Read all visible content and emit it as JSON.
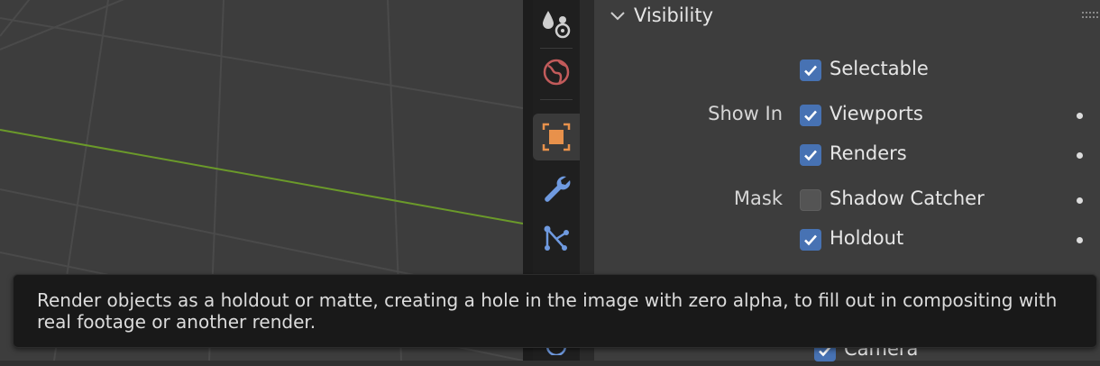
{
  "panel": {
    "title": "Visibility",
    "rows": [
      {
        "label": "",
        "option": "Selectable",
        "checked": true,
        "has_dot": false
      },
      {
        "label": "Show In",
        "option": "Viewports",
        "checked": true,
        "has_dot": true
      },
      {
        "label": "",
        "option": "Renders",
        "checked": true,
        "has_dot": true
      },
      {
        "label": "Mask",
        "option": "Shadow Catcher",
        "checked": false,
        "has_dot": true
      },
      {
        "label": "",
        "option": "Holdout",
        "checked": true,
        "has_dot": true
      },
      {
        "label": "",
        "option": "Camera",
        "checked": true,
        "has_dot": false
      }
    ]
  },
  "tabs": [
    {
      "icon": "particles-icon"
    },
    {
      "icon": "world-icon"
    },
    {
      "icon": "object-icon",
      "active": true
    },
    {
      "icon": "modifier-wrench-icon"
    },
    {
      "icon": "particle-system-icon"
    },
    {
      "icon": "physics-icon"
    }
  ],
  "tooltip": {
    "text": "Render objects as a holdout or matte, creating a hole in the image with zero alpha, to fill out in compositing with real footage or another render."
  },
  "colors": {
    "accent": "#4772b3",
    "object_tab": "#e8914b",
    "wrench": "#6f9ae0",
    "world": "#c25b5b",
    "x_axis_line": "#6b9a2a"
  }
}
